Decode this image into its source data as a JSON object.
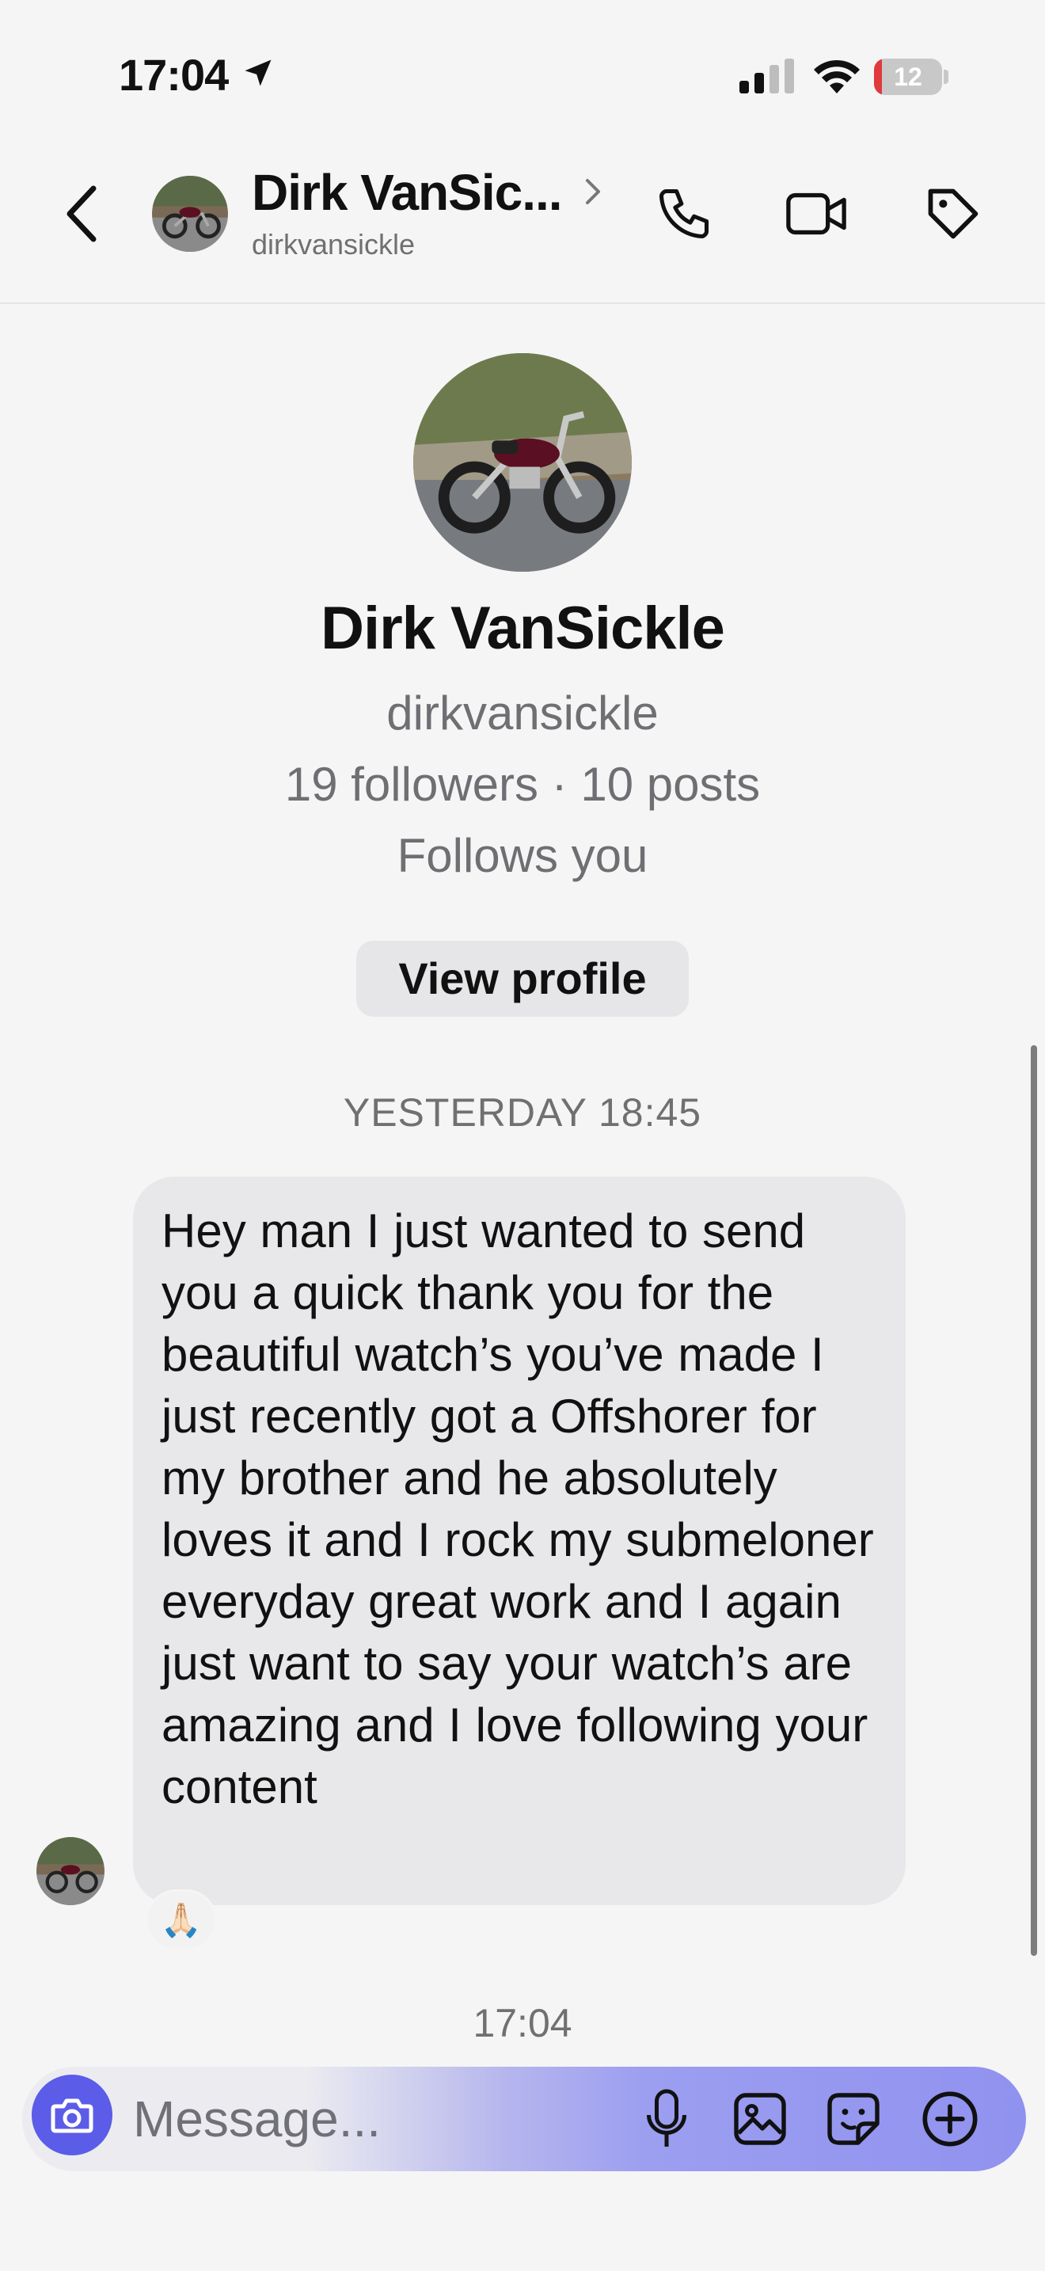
{
  "status_bar": {
    "time": "17:04",
    "battery_text": "12",
    "battery_level": 0.12,
    "icons": [
      "location-arrow-icon",
      "cellular-signal-icon",
      "wifi-icon",
      "battery-icon"
    ]
  },
  "header": {
    "name": "Dirk VanSic...",
    "username": "dirkvansickle",
    "actions": [
      "back-icon",
      "phone-icon",
      "video-camera-icon",
      "tag-icon"
    ]
  },
  "profile": {
    "name": "Dirk VanSickle",
    "username": "dirkvansickle",
    "stats": "19 followers · 10 posts",
    "follows_status": "Follows you",
    "view_profile_label": "View profile"
  },
  "conversation": {
    "date_separator": "YESTERDAY 18:45",
    "messages": [
      {
        "text": "Hey man I just wanted to send you a quick thank you for the beautiful watch’s you’ve made I just recently got a Offshorer for my brother and he absolutely loves it and I rock my submeloner everyday great work and I again just want to say your watch’s are amazing and I love following your content",
        "reaction": "🙏🏻"
      }
    ],
    "time_separator": "17:04"
  },
  "composer": {
    "placeholder": "Message...",
    "accent_color": "#5b5ce8"
  },
  "colors": {
    "background": "#f5f5f5",
    "bubble": "#e8e8ea",
    "battery_low": "#e0393e"
  }
}
